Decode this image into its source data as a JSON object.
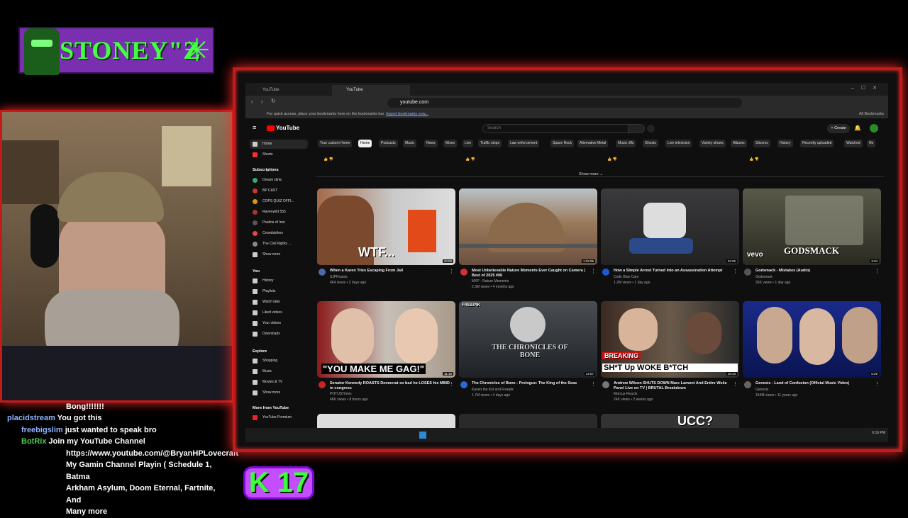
{
  "overlay": {
    "brand_text": "STONEY\"Z",
    "kick_badge": "K 17"
  },
  "chat": [
    {
      "user": "",
      "msg": "Bong!!!!!!!"
    },
    {
      "user": "placidstream",
      "msg": "You got this"
    },
    {
      "user": "freebigslim",
      "msg": "just wanted to speak bro"
    },
    {
      "user": "BotRix",
      "msg": "Join my YouTube Channel"
    }
  ],
  "chat_extra": [
    "https://www.youtube.com/@BryanHPLovecraft",
    "My Gamin Channel Playin ( Schedule 1, Batma",
    "Arkham Asylum, Doom Eternal, Fartnite, And",
    "Many more"
  ],
  "browser": {
    "tabs": [
      "YouTube",
      "YouTube"
    ],
    "url": "youtube.com",
    "bookmarks_hint": "For quick access, place your bookmarks here on the bookmarks bar.",
    "bookmarks_link": "Import bookmarks now...",
    "all_bookmarks": "All Bookmarks",
    "time": "6:16 PM"
  },
  "youtube": {
    "logo": "YouTube",
    "search_placeholder": "Search",
    "create": "+ Create",
    "show_more_top": "Show more",
    "sidebar": {
      "home": "Home",
      "shorts": "Shorts",
      "subscriptions_head": "Subscriptions",
      "subscriptions": [
        "Dream clinic",
        "BP CAST",
        "COPS QUIZ OFFI...",
        "Ravenwild 555",
        "Psalms of Iron",
        "Crowdstrikes",
        "The Civil Rights ..."
      ],
      "subs_show_more": "Show more",
      "you_head": "You",
      "you": [
        "History",
        "Playlists",
        "Watch later",
        "Liked videos",
        "Your videos",
        "Downloads"
      ],
      "explore_head": "Explore",
      "explore": [
        "Shopping",
        "Music",
        "Movies & TV"
      ],
      "explore_show_more": "Show more",
      "more_head": "More from YouTube",
      "more": [
        "YouTube Premium"
      ]
    },
    "chips": [
      "Your custom Home",
      "Home",
      "Podcasts",
      "Music",
      "News",
      "Mixes",
      "Live",
      "Traffic stops",
      "Law enforcement",
      "Space Rock",
      "Alternative Metal",
      "Music riffs",
      "Ghosts",
      "Live television",
      "Variety shows",
      "Albums",
      "Sitcoms",
      "History",
      "Recently uploaded",
      "Watched",
      "Ne"
    ],
    "videos": [
      {
        "title": "When a Karen Tries Escaping From Jail",
        "channel": "SJPRoasts",
        "meta": "464 views • 2 days ago",
        "duration": "10:03",
        "overlay": "WTF..."
      },
      {
        "title": "Most Unbelievable Nature Moments Ever Caught on Camera | Best of 2025 #06",
        "channel": "MXP - Nature Moments",
        "meta": "2.3M views • 4 months ago",
        "duration": "1:02:05",
        "overlay": ""
      },
      {
        "title": "How a Simple Arrest Turned Into an Assassination Attempt",
        "channel": "Code Blue Cam",
        "meta": "1.2M views • 1 day ago",
        "duration": "22:25",
        "overlay": ""
      },
      {
        "title": "Godsmack - Mistakes (Audio)",
        "channel": "Godsmack",
        "meta": "26K views • 1 day ago",
        "duration": "3:34",
        "overlay": "GODSMACK"
      },
      {
        "title": "Senator Kennedy ROASTS Democrat so bad he LOSES his MIND in congress",
        "channel": "POTUSTimes",
        "meta": "46K views • 8 hours ago",
        "duration": "11:16",
        "overlay": "\"YOU MAKE ME GAG!\""
      },
      {
        "title": "The Chronicles of Bone - Prologue: The King of the Seas",
        "channel": "Kaven the Kid and Freepik",
        "meta": "1.7M views • 4 days ago",
        "duration": "14:57",
        "overlay": "THE CHRONICLES OF BONE"
      },
      {
        "title": "Andrew Wilson SHUTS DOWN Marc Lamont And Entire Woke Panel Live on TV | BRUTAL Breakdown",
        "channel": "Marcus Reacts",
        "meta": "24K views • 2 weeks ago",
        "duration": "18:43",
        "overlay": "SH*T Up WOKE B*TCH"
      },
      {
        "title": "Genesis - Land of Confusion (Official Music Video)",
        "channel": "Genesis",
        "meta": "154M views • 11 years ago",
        "duration": "5:29",
        "overlay": ""
      }
    ],
    "breaking": "BREAKING",
    "vevo": "vevo",
    "freepik": "FREEPIK",
    "ucc": "UCC?"
  }
}
